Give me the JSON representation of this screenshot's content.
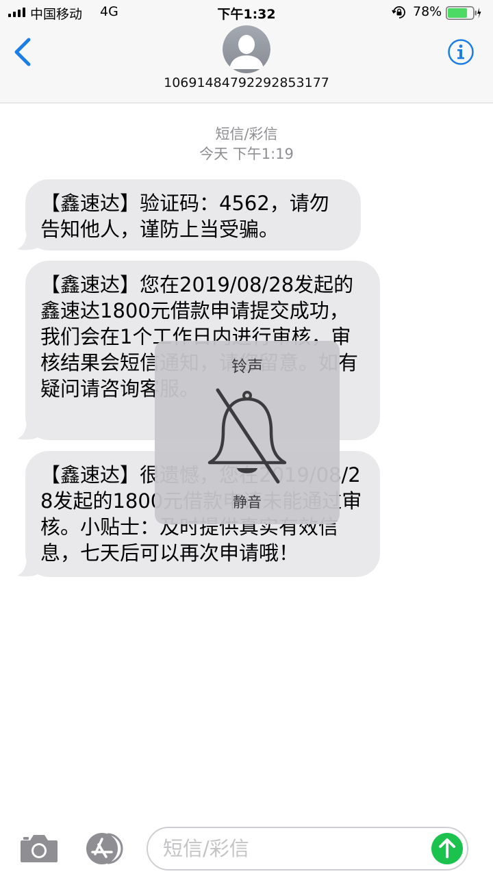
{
  "status_bar": {
    "carrier": "中国移动",
    "network": "4G",
    "time": "下午1:32",
    "battery_percent": "78%",
    "battery_level": 0.78
  },
  "header": {
    "contact": "10691484792292853177"
  },
  "thread": {
    "message_type": "短信/彩信",
    "timestamp": "今天 下午1:19",
    "messages": [
      {
        "text": "【鑫速达】验证码：4562，请勿告知他人，谨防上当受骗。"
      },
      {
        "text": "【鑫速达】您在2019/08/28发起的鑫速达1800元借款申请提交成功，我们会在1个工作日内进行审核，审核结果会短信通知，请您留意。如有疑问请咨询客服。"
      },
      {
        "text": "【鑫速达】很遗憾，您在2019/08/28发起的1800元借款申请未能通过审核。小贴士：及时提供真实有效信息，七天后可以再次申请哦！"
      }
    ]
  },
  "ringer_hud": {
    "title": "铃声",
    "status": "静音",
    "icon": "bell-slash-icon"
  },
  "compose": {
    "placeholder": "短信/彩信"
  },
  "colors": {
    "accent": "#1a7ee6",
    "bubble": "#e9e9eb",
    "meta": "#8e8e93",
    "send": "#1bc24d",
    "battery": "#4cd964"
  }
}
